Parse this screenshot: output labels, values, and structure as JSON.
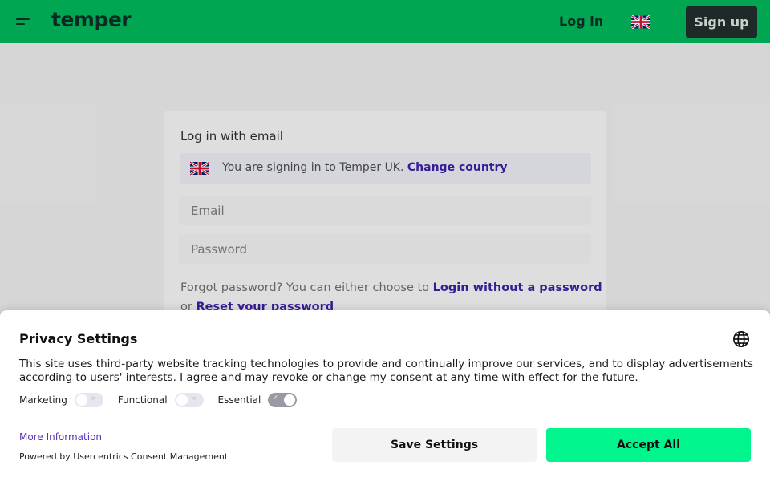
{
  "header": {
    "logo": "temper",
    "login_label": "Log in",
    "signup_label": "Sign up",
    "menu_icon": "hamburger-menu-icon",
    "flag_icon": "uk-flag-icon",
    "brand_color": "#00a651"
  },
  "login_form": {
    "title": "Log in with email",
    "country_notice": "You are signing in to Temper UK.",
    "change_country_label": "Change country",
    "email_placeholder": "Email",
    "password_placeholder": "Password",
    "forgot_text": "Forgot password? You can either choose to",
    "login_without_password_label": "Login without a password",
    "or_text": "or",
    "reset_password_label": "Reset your password"
  },
  "consent": {
    "title": "Privacy Settings",
    "description": "This site uses third-party website tracking technologies to provide and continually improve our services, and to display advertisements according to users' interests. I agree and may revoke or change my consent at any time with effect for the future.",
    "toggles": {
      "marketing_label": "Marketing",
      "marketing_on": false,
      "functional_label": "Functional",
      "functional_on": false,
      "essential_label": "Essential",
      "essential_on": true
    },
    "more_info_label": "More Information",
    "powered_by": "Powered by Usercentrics Consent Management",
    "save_label": "Save Settings",
    "accept_label": "Accept All",
    "accept_color": "#00f58d",
    "globe_icon": "globe-icon"
  }
}
